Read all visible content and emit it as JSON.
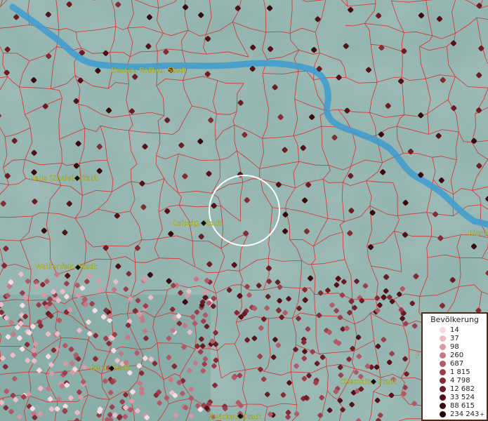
{
  "map": {
    "cities": [
      {
        "name": "Dessau-Roßlau, Stadt"
      },
      {
        "name": "Halle (Saale), Stadt"
      },
      {
        "name": "Leipzig, Stadt"
      },
      {
        "name": "Weißenfels, Stadt"
      },
      {
        "name": "Gera, Stadt"
      },
      {
        "name": "Chemnitz, Stadt"
      },
      {
        "name": "Zwickau, Stadt"
      },
      {
        "name": "Riesa"
      },
      {
        "name": "F"
      }
    ],
    "colors": {
      "background": "#8fb1ac",
      "borders": "#d9302f",
      "river": "#3d9ccf",
      "label": "#f1f32a",
      "selection_circle": "#ffffff"
    }
  },
  "legend": {
    "title": "Bevölkerung",
    "items": [
      {
        "label": "14",
        "color": "#f6dbe2"
      },
      {
        "label": "37",
        "color": "#e9bcc7"
      },
      {
        "label": "98",
        "color": "#d89aa7"
      },
      {
        "label": "260",
        "color": "#c57986"
      },
      {
        "label": "687",
        "color": "#b05a67"
      },
      {
        "label": "1 815",
        "color": "#9a404c"
      },
      {
        "label": "4 798",
        "color": "#832c36"
      },
      {
        "label": "12 682",
        "color": "#6b1d26"
      },
      {
        "label": "33 524",
        "color": "#531219"
      },
      {
        "label": "88 615",
        "color": "#3a0a0f"
      },
      {
        "label": "234 243",
        "color": "#1f0306",
        "suffix": "+"
      }
    ]
  }
}
